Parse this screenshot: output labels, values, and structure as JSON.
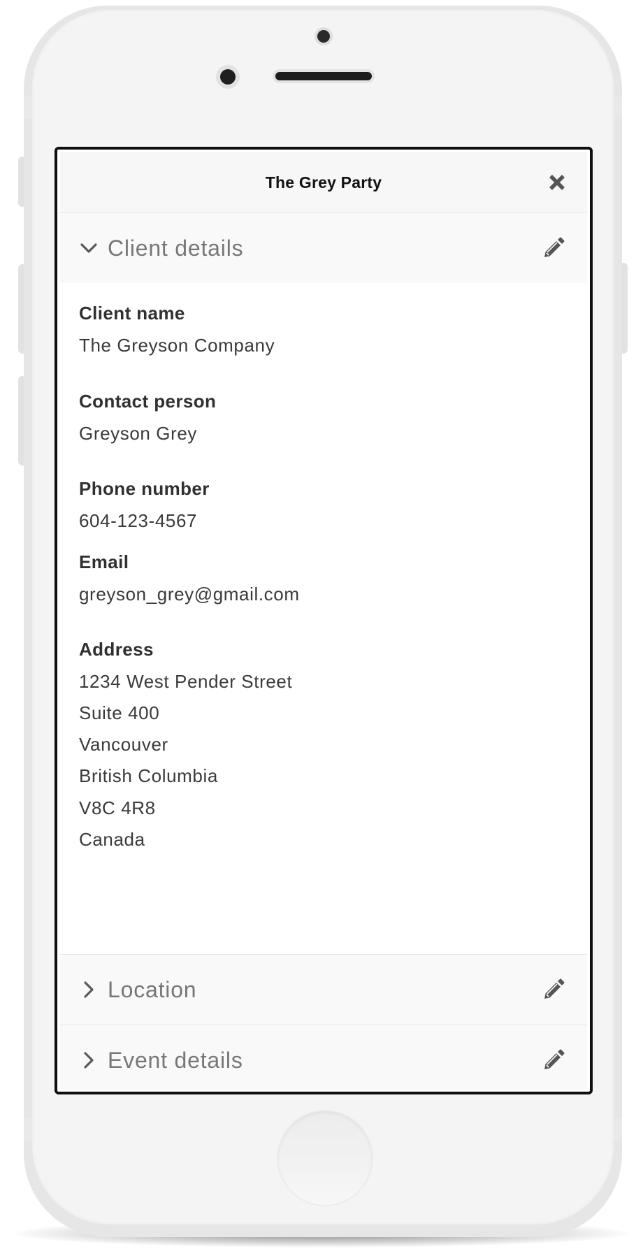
{
  "modal": {
    "title": "The Grey Party",
    "close_icon": "close-icon"
  },
  "sections": [
    {
      "title": "Client details",
      "expanded": true,
      "chevron_icon": "chevron-down-icon",
      "edit_icon": "pencil-icon",
      "fields": {
        "client_name": {
          "label": "Client name",
          "value": "The Greyson Company"
        },
        "contact_person": {
          "label": "Contact person",
          "value": "Greyson Grey"
        },
        "phone_number": {
          "label": "Phone number",
          "value": "604-123-4567"
        },
        "email": {
          "label": "Email",
          "value": "greyson_grey@gmail.com"
        },
        "address": {
          "label": "Address",
          "lines": [
            "1234 West Pender Street",
            "Suite 400",
            "Vancouver",
            "British Columbia",
            "V8C 4R8",
            "Canada"
          ]
        }
      }
    },
    {
      "title": "Location",
      "expanded": false,
      "chevron_icon": "chevron-right-icon",
      "edit_icon": "pencil-icon"
    },
    {
      "title": "Event details",
      "expanded": false,
      "chevron_icon": "chevron-right-icon",
      "edit_icon": "pencil-icon"
    }
  ],
  "colors": {
    "section_title": "#777777",
    "label": "#303030",
    "value": "#3a3a3a",
    "icon": "#555555",
    "screen_border": "#0f0f0f"
  }
}
